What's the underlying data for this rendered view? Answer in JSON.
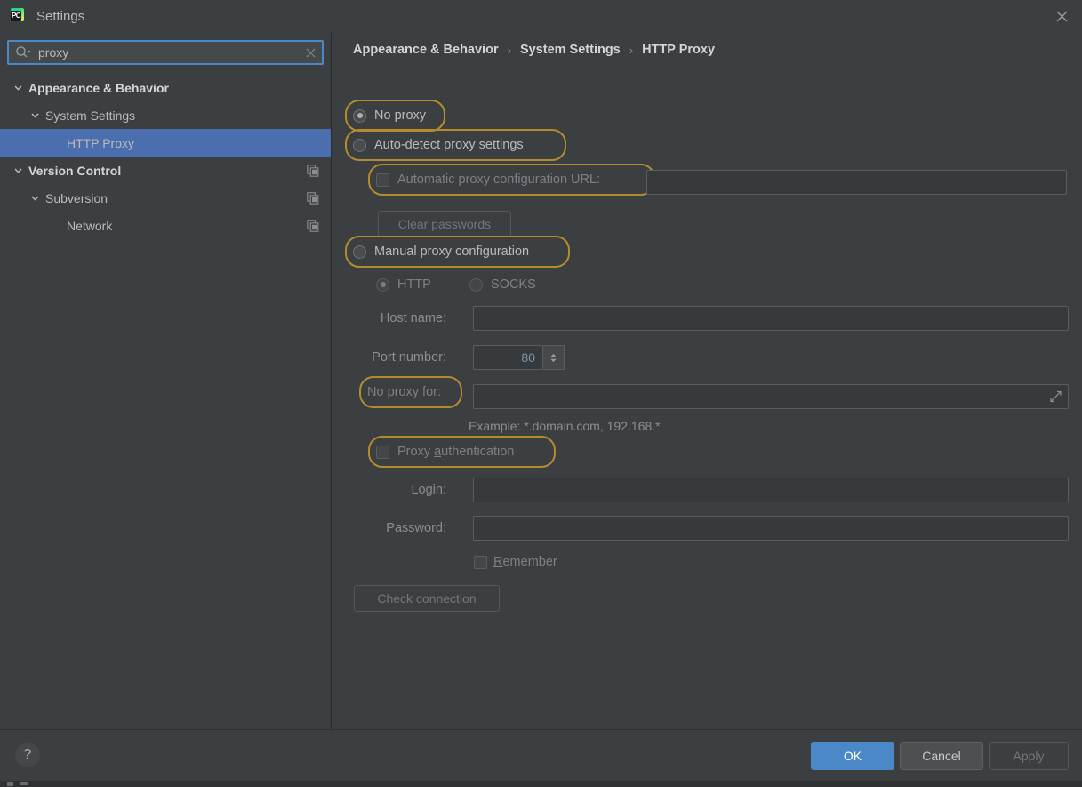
{
  "window": {
    "title": "Settings",
    "app_icon": "pycharm-icon",
    "close_icon": "close-icon"
  },
  "search": {
    "value": "proxy",
    "placeholder": "",
    "icon": "search-icon",
    "clear_icon": "clear-icon"
  },
  "sidebar": {
    "items": [
      {
        "label": "Appearance & Behavior",
        "indent": 0,
        "expanded": true,
        "bold": true,
        "selected": false,
        "copy_icon": false
      },
      {
        "label": "System Settings",
        "indent": 1,
        "expanded": true,
        "bold": false,
        "selected": false,
        "copy_icon": false
      },
      {
        "label": "HTTP Proxy",
        "indent": 2,
        "expanded": null,
        "bold": false,
        "selected": true,
        "copy_icon": false
      },
      {
        "label": "Version Control",
        "indent": 0,
        "expanded": true,
        "bold": true,
        "selected": false,
        "copy_icon": true
      },
      {
        "label": "Subversion",
        "indent": 1,
        "expanded": true,
        "bold": false,
        "selected": false,
        "copy_icon": true
      },
      {
        "label": "Network",
        "indent": 2,
        "expanded": null,
        "bold": false,
        "selected": false,
        "copy_icon": true
      }
    ]
  },
  "breadcrumb": {
    "items": [
      "Appearance & Behavior",
      "System Settings",
      "HTTP Proxy"
    ],
    "separator": "›"
  },
  "proxy": {
    "no_proxy_label": "No proxy",
    "no_proxy_selected": true,
    "auto_detect_label": "Auto-detect proxy settings",
    "auto_detect_selected": false,
    "auto_config_url_label": "Automatic proxy configuration URL:",
    "auto_config_url_checked": false,
    "auto_config_url_value": "",
    "clear_passwords_label": "Clear passwords",
    "manual_label": "Manual proxy configuration",
    "manual_selected": false,
    "http_label": "HTTP",
    "http_selected": true,
    "socks_label": "SOCKS",
    "socks_selected": false,
    "host_name_label": "Host name:",
    "host_name_value": "",
    "port_number_label": "Port number:",
    "port_number_value": "80",
    "no_proxy_for_label": "No proxy for:",
    "no_proxy_for_value": "",
    "expand_icon": "expand-icon",
    "example_text": "Example: *.domain.com, 192.168.*",
    "proxy_auth_label_pre": "Proxy ",
    "proxy_auth_label_mnemonic": "a",
    "proxy_auth_label_post": "uthentication",
    "proxy_auth_checked": false,
    "login_label": "Login:",
    "login_value": "",
    "password_label": "Password:",
    "password_value": "",
    "remember_label_mnemonic": "R",
    "remember_label_post": "emember",
    "remember_checked": false,
    "check_connection_label": "Check connection"
  },
  "footer": {
    "help_icon": "help-icon",
    "help_label": "?",
    "ok_label": "OK",
    "cancel_label": "Cancel",
    "apply_label": "Apply"
  },
  "colors": {
    "background": "#3c3f41",
    "selection_blue": "#4b6eaf",
    "accent_blue": "#4a88c7",
    "highlight_gold": "#b58b2e",
    "text": "#bbbbbb",
    "text_dim": "#7d8184"
  }
}
